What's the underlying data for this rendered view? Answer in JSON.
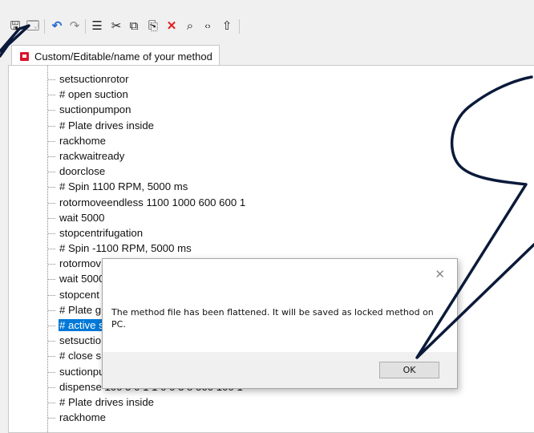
{
  "toolbar": {
    "icons": [
      {
        "name": "save-icon",
        "glyph": "🖫"
      },
      {
        "name": "save-as-icon",
        "glyph": "🗔"
      },
      {
        "name": "undo-icon",
        "glyph": "↶"
      },
      {
        "name": "redo-icon",
        "glyph": "↷"
      },
      {
        "name": "insert-icon",
        "glyph": "☰"
      },
      {
        "name": "cut-icon",
        "glyph": "✂"
      },
      {
        "name": "copy-icon",
        "glyph": "⧉"
      },
      {
        "name": "paste-icon",
        "glyph": "⎘"
      },
      {
        "name": "delete-icon",
        "glyph": "✕"
      },
      {
        "name": "find-icon",
        "glyph": "⌕"
      },
      {
        "name": "code-icon",
        "glyph": "‹›"
      },
      {
        "name": "export-icon",
        "glyph": "⇧"
      }
    ]
  },
  "tab": {
    "label": "Custom/Editable/name of your method"
  },
  "tree": {
    "items": [
      {
        "label": "setsuctionrotor"
      },
      {
        "label": "# open suction"
      },
      {
        "label": "suctionpumpon"
      },
      {
        "label": "# Plate drives inside"
      },
      {
        "label": "rackhome"
      },
      {
        "label": "rackwaitready"
      },
      {
        "label": "doorclose"
      },
      {
        "label": "# Spin 1100 RPM, 5000 ms"
      },
      {
        "label": "rotormoveendless 1100 1000 600 600 1"
      },
      {
        "label": "wait 5000"
      },
      {
        "label": "stopcentrifugation"
      },
      {
        "label": "# Spin -1100 RPM, 5000 ms"
      },
      {
        "label": "rotormov"
      },
      {
        "label": "wait 5000"
      },
      {
        "label": "stopcent"
      },
      {
        "label": "# Plate g"
      },
      {
        "label": "# active s",
        "selected": true
      },
      {
        "label": "setsuctio"
      },
      {
        "label": "# close s"
      },
      {
        "label": "suctionpu"
      },
      {
        "label": "dispense 100 5 0 1 1 0 0 3 5 500 100 1"
      },
      {
        "label": "# Plate drives inside"
      },
      {
        "label": "rackhome"
      }
    ]
  },
  "dialog": {
    "message": "The method file has been flattened. It will be saved as locked method on PC.",
    "ok_label": "OK",
    "close_glyph": "✕"
  },
  "colors": {
    "annotation": "#0b1a3a",
    "selection": "#0078d7",
    "tab_icon": "#d9162c"
  }
}
